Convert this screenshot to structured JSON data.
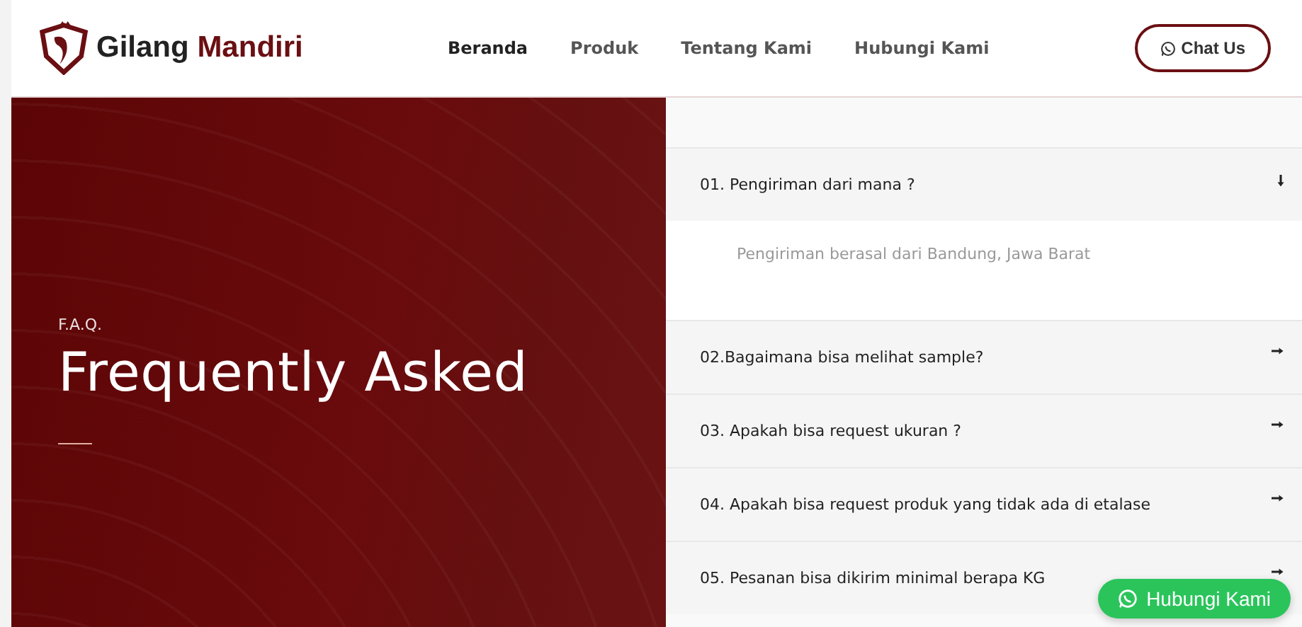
{
  "header": {
    "brand": {
      "first": "Gilang",
      "second": "Mandiri"
    },
    "nav": [
      {
        "label": "Beranda",
        "selected": true
      },
      {
        "label": "Produk",
        "selected": false
      },
      {
        "label": "Tentang Kami",
        "selected": false
      },
      {
        "label": "Hubungi Kami",
        "selected": false
      }
    ],
    "chat_button": "Chat Us"
  },
  "hero": {
    "eyebrow": "F.A.Q.",
    "title": "Frequently Asked"
  },
  "faq": [
    {
      "question": "01. Pengiriman dari mana ?",
      "expanded": true,
      "answer": "Pengiriman berasal dari Bandung, Jawa Barat"
    },
    {
      "question": "02.Bagaimana bisa melihat sample?",
      "expanded": false
    },
    {
      "question": "03. Apakah bisa request ukuran ?",
      "expanded": false
    },
    {
      "question": "04. Apakah bisa request produk yang tidak ada di etalase",
      "expanded": false
    },
    {
      "question": "05. Pesanan bisa dikirim minimal berapa KG",
      "expanded": false
    }
  ],
  "floating_button": "Hubungi Kami"
}
